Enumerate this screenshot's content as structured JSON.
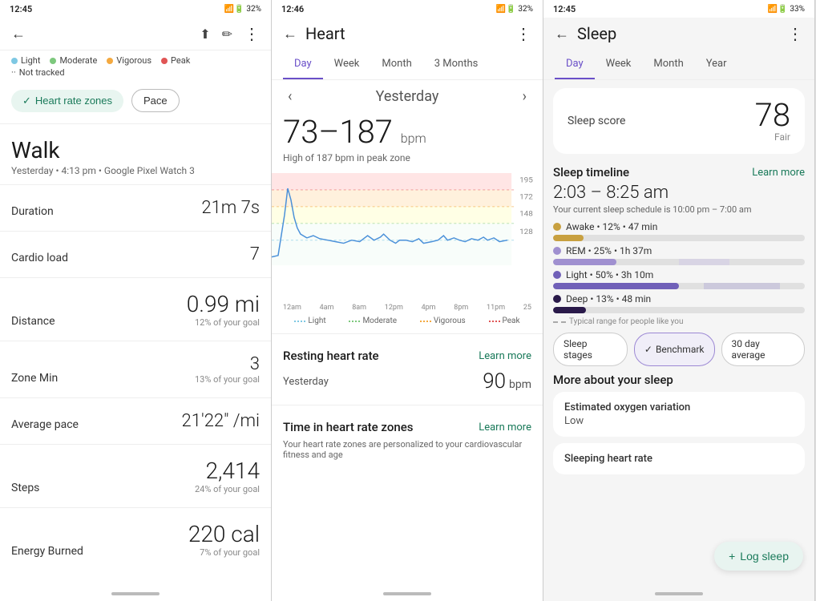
{
  "panel1": {
    "status": {
      "time": "12:45",
      "battery": "32%"
    },
    "legend": [
      {
        "id": "light",
        "label": "Light",
        "color": "#7ec8e3"
      },
      {
        "id": "moderate",
        "label": "Moderate",
        "color": "#7dc87d"
      },
      {
        "id": "vigorous",
        "label": "Vigorous",
        "color": "#f4a940"
      },
      {
        "id": "peak",
        "label": "Peak",
        "color": "#e05555"
      }
    ],
    "not_tracked": "Not tracked",
    "filters": {
      "active": "Heart rate zones",
      "inactive": "Pace"
    },
    "activity": {
      "title": "Walk",
      "subtitle": "Yesterday • 4:13 pm • Google Pixel Watch 3"
    },
    "metrics": [
      {
        "label": "Duration",
        "value": "21m 7s",
        "sub": ""
      },
      {
        "label": "Cardio load",
        "value": "7",
        "sub": ""
      },
      {
        "label": "Distance",
        "value": "0.99 mi",
        "sub": "12% of your goal"
      },
      {
        "label": "Zone Min",
        "value": "3",
        "sub": "13% of your goal"
      },
      {
        "label": "Average pace",
        "value": "21'22\" /mi",
        "sub": ""
      },
      {
        "label": "Steps",
        "value": "2,414",
        "sub": "24% of your goal"
      },
      {
        "label": "Energy Burned",
        "value": "220 cal",
        "sub": "7% of your goal"
      }
    ]
  },
  "panel2": {
    "status": {
      "time": "12:46",
      "battery": "32%"
    },
    "title": "Heart",
    "tabs": [
      "Day",
      "Week",
      "Month",
      "3 Months"
    ],
    "active_tab": "Day",
    "date": "Yesterday",
    "bpm_range": "73–187",
    "bpm_unit": "bpm",
    "bpm_note": "High of 187 bpm in peak zone",
    "chart_y_labels": [
      "195",
      "172",
      "148",
      "128"
    ],
    "zone_labels": [
      "Light",
      "Moderate",
      "Vigorous",
      "Peak"
    ],
    "time_labels": [
      "12am",
      "4am",
      "8am",
      "12pm",
      "4pm",
      "8pm",
      "11pm"
    ],
    "right_label": "25",
    "resting_hr": {
      "label": "Resting heart rate",
      "learn_more": "Learn more",
      "yesterday_label": "Yesterday",
      "value": "90",
      "unit": "bpm"
    },
    "zones": {
      "label": "Time in heart rate zones",
      "learn_more": "Learn more",
      "note": "Your heart rate zones are personalized to your cardiovascular fitness and age"
    }
  },
  "panel3": {
    "status": {
      "time": "12:45",
      "battery": "33%"
    },
    "title": "Sleep",
    "tabs": [
      "Day",
      "Week",
      "Month",
      "Year"
    ],
    "active_tab": "Day",
    "score": {
      "label": "Sleep score",
      "value": "78",
      "sub": "Fair"
    },
    "timeline": {
      "label": "Sleep timeline",
      "learn_more": "Learn more",
      "time": "2:03 – 8:25 am",
      "schedule": "Your current sleep schedule is 10:00 pm – 7:00 am"
    },
    "stages": [
      {
        "id": "awake",
        "label": "Awake",
        "pct": "12%",
        "duration": "47 min",
        "color": "#c8a040",
        "fill_pct": 12
      },
      {
        "id": "rem",
        "label": "REM",
        "pct": "25%",
        "duration": "1h 37m",
        "color": "#a090d0",
        "fill_pct": 25
      },
      {
        "id": "light",
        "label": "Light",
        "pct": "50%",
        "duration": "3h 10m",
        "color": "#7060b8",
        "fill_pct": 50
      },
      {
        "id": "deep",
        "label": "Deep",
        "pct": "13%",
        "duration": "48 min",
        "color": "#2a1a4a",
        "fill_pct": 13
      }
    ],
    "typical_note": "Typical range for people like you",
    "chips": [
      {
        "label": "Sleep stages",
        "active": false
      },
      {
        "label": "Benchmark",
        "active": true
      },
      {
        "label": "30 day average",
        "active": false
      }
    ],
    "more_section": {
      "title": "More about your sleep",
      "cards": [
        {
          "title": "Estimated oxygen variation",
          "value": "Low"
        },
        {
          "title": "Sleeping heart rate",
          "value": ""
        }
      ]
    },
    "log_sleep": "+ Log sleep"
  }
}
